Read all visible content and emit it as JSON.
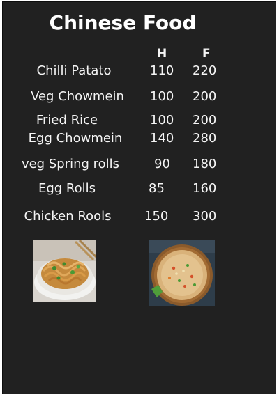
{
  "menu": {
    "title": "Chinese Food",
    "col_half": "H",
    "col_full": "F",
    "items": [
      {
        "name": "Chilli Patato",
        "half": "110",
        "full": "220"
      },
      {
        "name": "Veg Chowmein",
        "half": "100",
        "full": "200"
      },
      {
        "name": "Fried Rice",
        "half": "100",
        "full": "200"
      },
      {
        "name": "Egg Chowmein",
        "half": "140",
        "full": "280"
      },
      {
        "name": "veg Spring rolls",
        "half": "90",
        "full": "180"
      },
      {
        "name": "Egg Rolls",
        "half": "85",
        "full": "160"
      },
      {
        "name": "Chicken Rools",
        "half": "150",
        "full": "300"
      }
    ]
  },
  "colors": {
    "board": "#212121",
    "text": "#f5f5f5"
  }
}
